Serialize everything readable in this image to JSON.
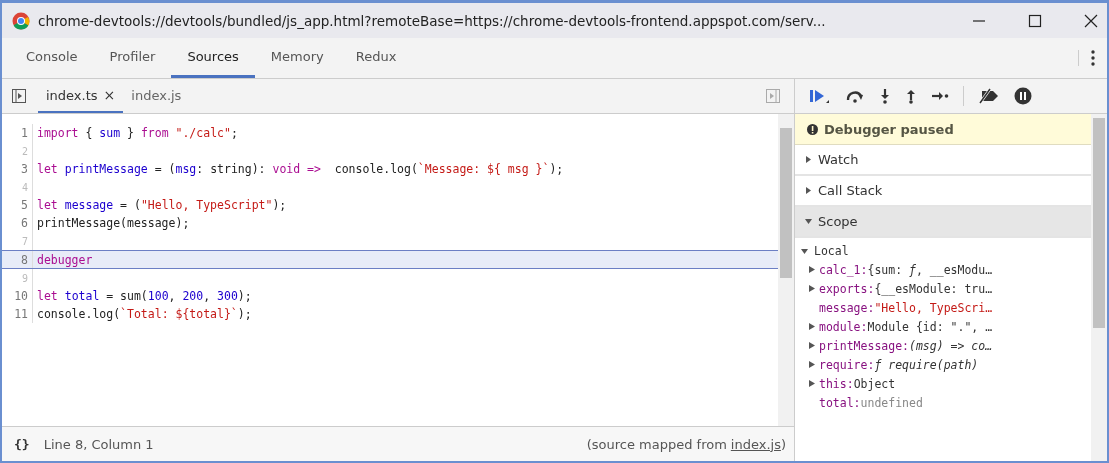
{
  "window": {
    "title": "chrome-devtools://devtools/bundled/js_app.html?remoteBase=https://chrome-devtools-frontend.appspot.com/serv..."
  },
  "tabs": [
    {
      "label": "Console",
      "selected": false
    },
    {
      "label": "Profiler",
      "selected": false
    },
    {
      "label": "Sources",
      "selected": true
    },
    {
      "label": "Memory",
      "selected": false
    },
    {
      "label": "Redux",
      "selected": false
    }
  ],
  "file_tabs": [
    {
      "label": "index.ts",
      "selected": true,
      "close": "×"
    },
    {
      "label": "index.js",
      "selected": false
    }
  ],
  "editor": {
    "lines": [
      {
        "number": "1",
        "highlighted": false,
        "tokens": [
          {
            "kind": "keyword",
            "text": "import"
          },
          {
            "kind": "plain",
            "text": " { "
          },
          {
            "kind": "variable",
            "text": "sum"
          },
          {
            "kind": "plain",
            "text": " } "
          },
          {
            "kind": "keyword",
            "text": "from "
          },
          {
            "kind": "string",
            "text": "\"./calc\""
          },
          {
            "kind": "plain",
            "text": ";"
          }
        ]
      },
      {
        "number": "2",
        "highlighted": false
      },
      {
        "number": "3",
        "highlighted": false,
        "tokens": [
          {
            "kind": "keyword",
            "text": "let "
          },
          {
            "kind": "variable",
            "text": "printMessage"
          },
          {
            "kind": "plain",
            "text": " = ("
          },
          {
            "kind": "variable",
            "text": "msg"
          },
          {
            "kind": "plain",
            "text": ": string): "
          },
          {
            "kind": "keyword",
            "text": "void =>"
          },
          {
            "kind": "plain",
            "text": "  console.log("
          },
          {
            "kind": "string",
            "text": "`Message: ${ msg }`"
          },
          {
            "kind": "plain",
            "text": ");"
          }
        ]
      },
      {
        "number": "4",
        "highlighted": false
      },
      {
        "number": "5",
        "highlighted": false,
        "tokens": [
          {
            "kind": "keyword",
            "text": "let "
          },
          {
            "kind": "variable",
            "text": "message"
          },
          {
            "kind": "plain",
            "text": " = ("
          },
          {
            "kind": "string",
            "text": "\"Hello, TypeScript\""
          },
          {
            "kind": "plain",
            "text": ");"
          }
        ]
      },
      {
        "number": "6",
        "highlighted": false,
        "tokens": [
          {
            "kind": "plain",
            "text": "printMessage(message);"
          }
        ]
      },
      {
        "number": "7",
        "highlighted": false
      },
      {
        "number": "8",
        "highlighted": true,
        "tokens": [
          {
            "kind": "keyword",
            "text": "debugger"
          }
        ]
      },
      {
        "number": "9",
        "highlighted": false
      },
      {
        "number": "10",
        "highlighted": false,
        "tokens": [
          {
            "kind": "keyword",
            "text": "let "
          },
          {
            "kind": "variable",
            "text": "total"
          },
          {
            "kind": "plain",
            "text": " = sum("
          },
          {
            "kind": "number",
            "text": "100"
          },
          {
            "kind": "plain",
            "text": ", "
          },
          {
            "kind": "number",
            "text": "200"
          },
          {
            "kind": "plain",
            "text": ", "
          },
          {
            "kind": "number",
            "text": "300"
          },
          {
            "kind": "plain",
            "text": ");"
          }
        ]
      },
      {
        "number": "11",
        "highlighted": false,
        "tokens": [
          {
            "kind": "plain",
            "text": "console.log("
          },
          {
            "kind": "string",
            "text": "`Total: ${total}`"
          },
          {
            "kind": "plain",
            "text": ");"
          }
        ]
      }
    ]
  },
  "status_bar": {
    "format": "{}",
    "position": "Line 8, Column 1",
    "source_prefix": "(source mapped from",
    "source_link": "index.js",
    "source_suffix": ")"
  },
  "debugger": {
    "banner": "Debugger paused",
    "sections": [
      {
        "label": "Watch",
        "expanded": false
      },
      {
        "label": "Call Stack",
        "expanded": false
      },
      {
        "label": "Scope",
        "expanded": true
      }
    ],
    "scope": {
      "label": "Local",
      "expanded": true,
      "items": [
        {
          "key": "calc_1:",
          "value": "{sum: *ƒ*, __esModu…",
          "expandable": true,
          "kind": "object"
        },
        {
          "key": "exports:",
          "value": "{__esModule: tru…",
          "expandable": true,
          "kind": "object"
        },
        {
          "key": "message:",
          "value": "\"Hello, TypeScri…",
          "expandable": false,
          "kind": "string"
        },
        {
          "key": "module:",
          "value": "Module {id: \".\", …",
          "expandable": true,
          "kind": "object"
        },
        {
          "key": "printMessage:",
          "value": "(msg) => co…",
          "expandable": true,
          "kind": "function"
        },
        {
          "key": "require:",
          "value": "ƒ require(path)",
          "expandable": true,
          "kind": "function"
        },
        {
          "key": "this:",
          "value": "Object",
          "expandable": true,
          "kind": "object"
        },
        {
          "key": "total:",
          "value": "undefined",
          "expandable": false,
          "kind": "undefined"
        }
      ]
    }
  }
}
